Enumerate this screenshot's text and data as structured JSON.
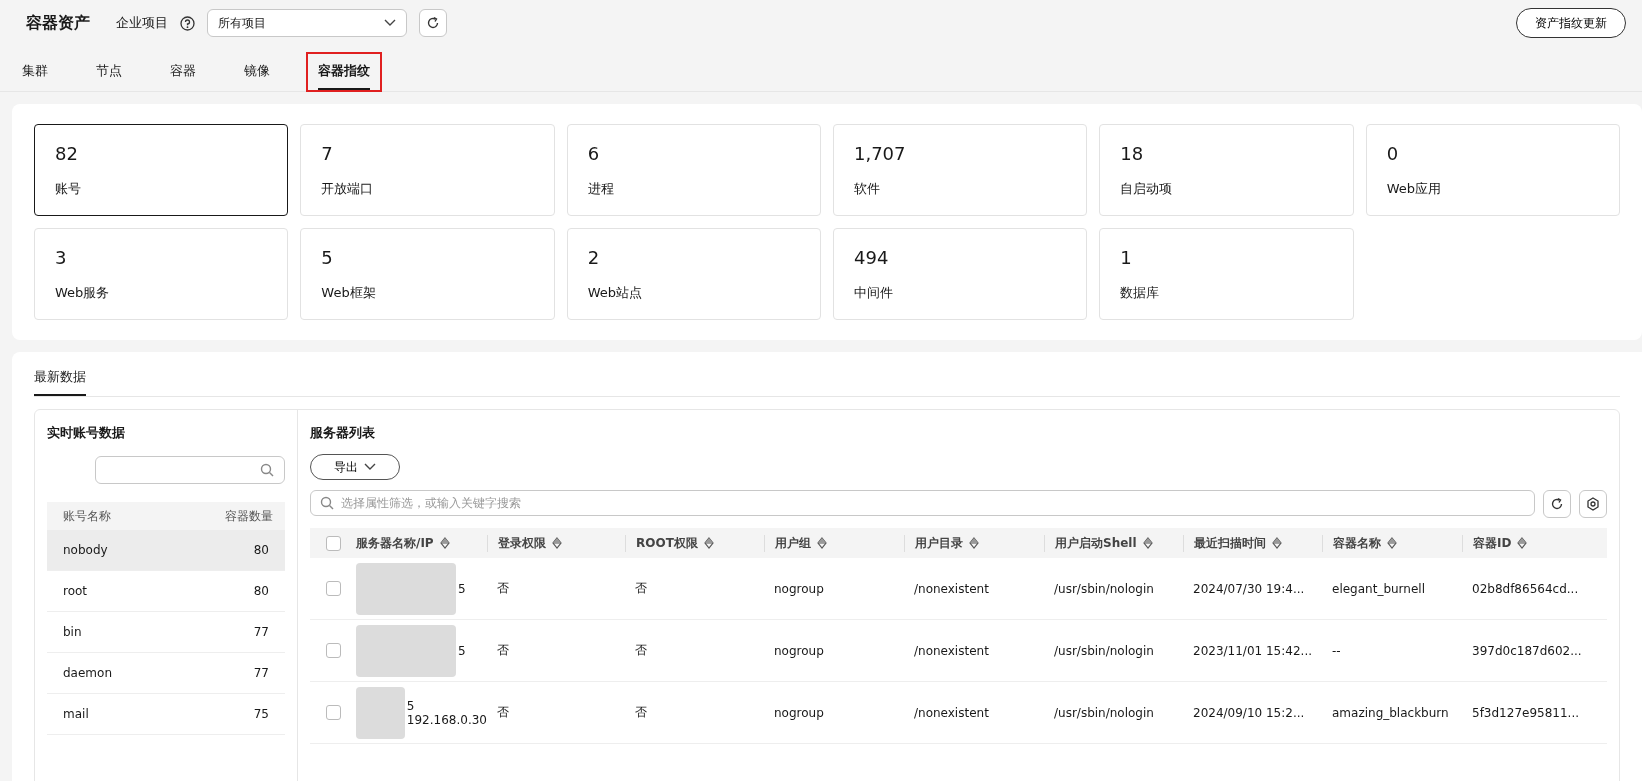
{
  "header": {
    "title": "容器资产",
    "project_label": "企业项目",
    "project_select": {
      "value": "所有项目"
    },
    "update_button": "资产指纹更新"
  },
  "tabs": [
    {
      "label": "集群",
      "selected": false
    },
    {
      "label": "节点",
      "selected": false
    },
    {
      "label": "容器",
      "selected": false
    },
    {
      "label": "镜像",
      "selected": false
    },
    {
      "label": "容器指纹",
      "selected": true
    }
  ],
  "stats": [
    {
      "value": "82",
      "label": "账号",
      "selected": true
    },
    {
      "value": "7",
      "label": "开放端口",
      "selected": false
    },
    {
      "value": "6",
      "label": "进程",
      "selected": false
    },
    {
      "value": "1,707",
      "label": "软件",
      "selected": false
    },
    {
      "value": "18",
      "label": "自启动项",
      "selected": false
    },
    {
      "value": "0",
      "label": "Web应用",
      "selected": false
    },
    {
      "value": "3",
      "label": "Web服务",
      "selected": false
    },
    {
      "value": "5",
      "label": "Web框架",
      "selected": false
    },
    {
      "value": "2",
      "label": "Web站点",
      "selected": false
    },
    {
      "value": "494",
      "label": "中间件",
      "selected": false
    },
    {
      "value": "1",
      "label": "数据库",
      "selected": false
    }
  ],
  "section_tab": "最新数据",
  "accounts": {
    "title": "实时账号数据",
    "columns": [
      "账号名称",
      "容器数量"
    ],
    "rows": [
      {
        "name": "nobody",
        "count": "80",
        "selected": true
      },
      {
        "name": "root",
        "count": "80",
        "selected": false
      },
      {
        "name": "bin",
        "count": "77",
        "selected": false
      },
      {
        "name": "daemon",
        "count": "77",
        "selected": false
      },
      {
        "name": "mail",
        "count": "75",
        "selected": false
      }
    ]
  },
  "servers": {
    "title": "服务器列表",
    "export_button": "导出",
    "search_placeholder": "选择属性筛选，或输入关键字搜索",
    "columns": [
      "服务器名称/IP",
      "登录权限",
      "ROOT权限",
      "用户组",
      "用户目录",
      "用户启动Shell",
      "最近扫描时间",
      "容器名称",
      "容器ID"
    ],
    "select_all_checked": false,
    "rows": [
      {
        "checked": false,
        "server_name": [
          "5"
        ],
        "login": "否",
        "root": "否",
        "group": "nogroup",
        "home": "/nonexistent",
        "shell": "/usr/sbin/nologin",
        "scan_time": "2024/07/30 19:4...",
        "container_name": "elegant_burnell",
        "container_id": "02b8df86564cd..."
      },
      {
        "checked": false,
        "server_name": [
          "5"
        ],
        "login": "否",
        "root": "否",
        "group": "nogroup",
        "home": "/nonexistent",
        "shell": "/usr/sbin/nologin",
        "scan_time": "2023/11/01 15:42...",
        "container_name": "--",
        "container_id": "397d0c187d602..."
      },
      {
        "checked": false,
        "server_name": [
          "5",
          "192.168.0.30"
        ],
        "login": "否",
        "root": "否",
        "group": "nogroup",
        "home": "/nonexistent",
        "shell": "/usr/sbin/nologin",
        "scan_time": "2024/09/10 15:2...",
        "container_name": "amazing_blackburn",
        "container_id": "5f3d127e95811..."
      }
    ]
  }
}
